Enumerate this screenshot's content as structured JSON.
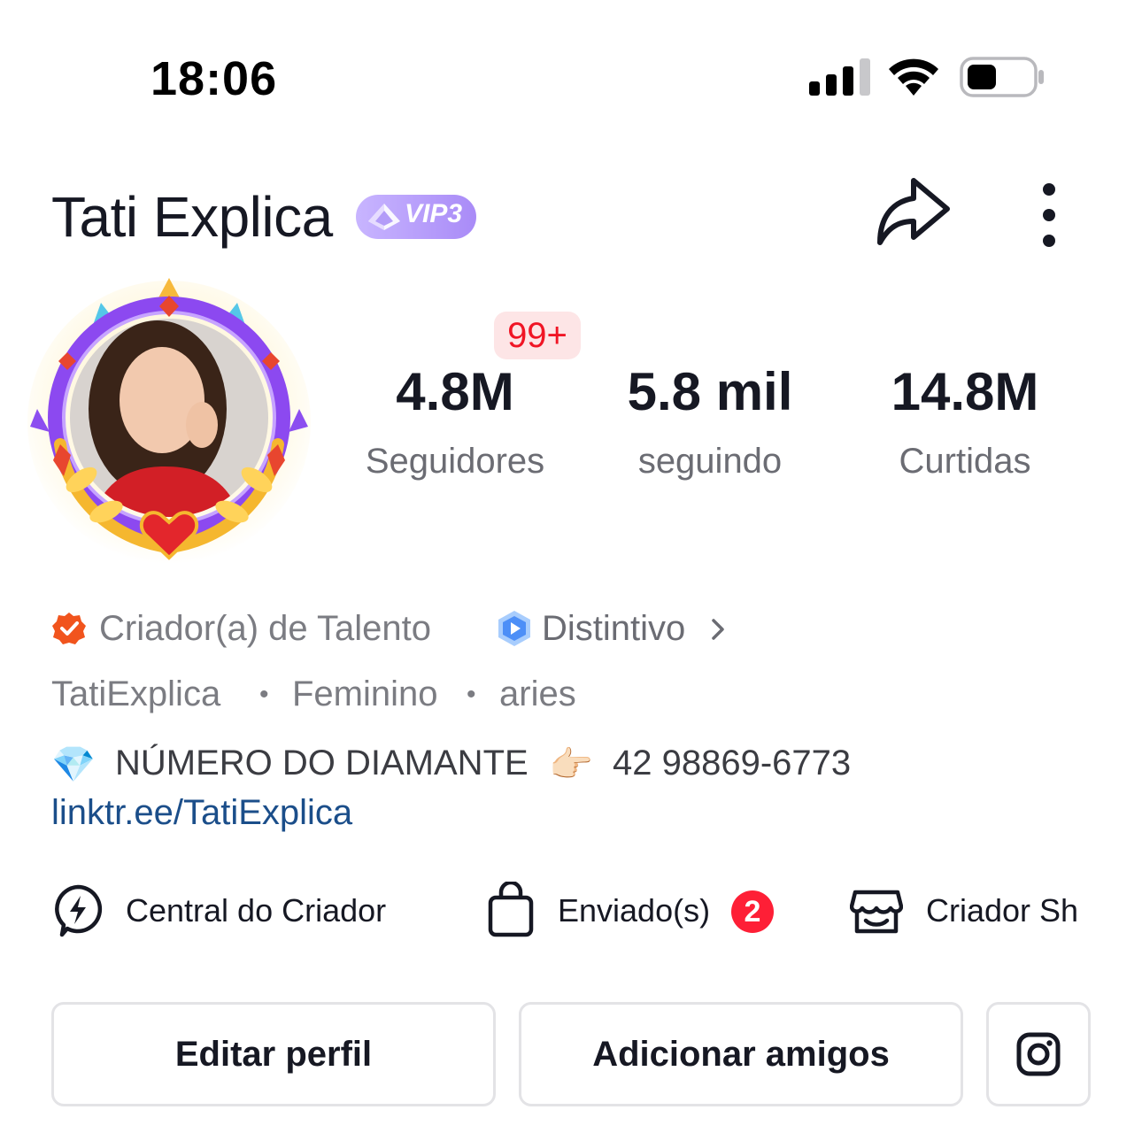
{
  "status_bar": {
    "time": "18:06"
  },
  "header": {
    "name": "Tati Explica",
    "vip_label": "VIP3",
    "share_icon": "share-arrow-icon",
    "more_icon": "more-vertical-icon"
  },
  "stats": {
    "followers": {
      "value": "4.8M",
      "label": "Seguidores",
      "badge": "99+"
    },
    "following": {
      "value": "5.8 mil",
      "label": "seguindo"
    },
    "likes": {
      "value": "14.8M",
      "label": "Curtidas"
    }
  },
  "tags": {
    "talent": "Criador(a) de Talento",
    "badge": "Distintivo",
    "username": "TatiExplica",
    "gender": "Feminino",
    "sign": "aries",
    "separator": "•"
  },
  "bio": {
    "diamond_emoji": "💎",
    "text": "NÚMERO DO DIAMANTE",
    "pointing_emoji": "👉🏻",
    "phone": "42 98869-6773",
    "link": "linktr.ee/TatiExplica"
  },
  "tools": [
    {
      "label": "Central do Criador",
      "icon": "lightning-bubble-icon"
    },
    {
      "label": "Enviado(s)",
      "icon": "shopping-bag-icon",
      "count": "2"
    },
    {
      "label": "Criador Sh",
      "icon": "shop-icon"
    }
  ],
  "actions": {
    "edit_profile": "Editar perfil",
    "add_friends": "Adicionar amigos",
    "instagram_icon": "instagram-icon"
  },
  "colors": {
    "accent_red": "#fe1f36",
    "link_blue": "#1b4e8a",
    "vip_purple": "#a98bf7",
    "talent_orange": "#f1541d",
    "badge_blue": "#4d8ff7"
  }
}
